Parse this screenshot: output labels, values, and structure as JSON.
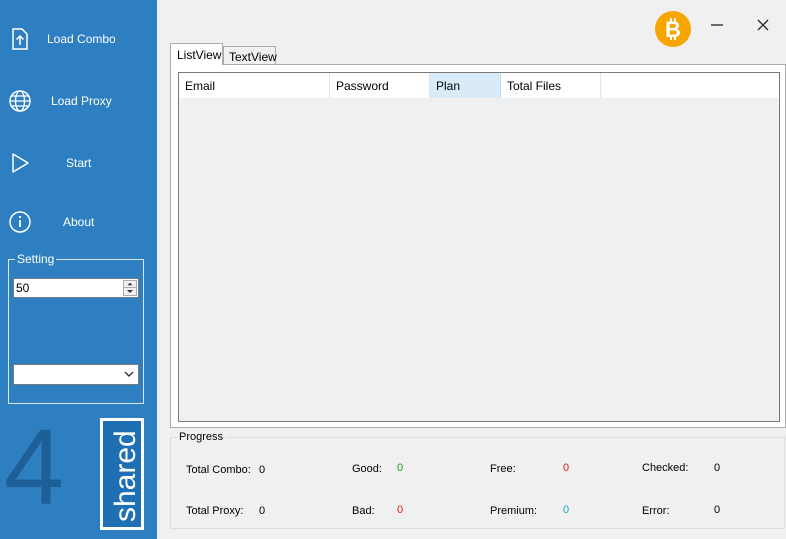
{
  "sidebar": {
    "load_combo": "Load Combo",
    "load_proxy": "Load Proxy",
    "start": "Start",
    "about": "About",
    "setting_label": "Setting",
    "threads_value": "50",
    "dropdown_value": "",
    "logo_number": "4",
    "logo_text": "shared",
    "color": "#2e7fc2"
  },
  "window": {
    "bitcoin_symbol": "B"
  },
  "tabs": [
    {
      "label": "ListView",
      "active": true
    },
    {
      "label": "TextView",
      "active": false
    }
  ],
  "listview": {
    "columns": [
      "Email",
      "Password",
      "Plan",
      "Total Files"
    ],
    "rows": []
  },
  "progress": {
    "label": "Progress",
    "total_combo_label": "Total Combo:",
    "total_combo_value": "0",
    "total_proxy_label": "Total Proxy:",
    "total_proxy_value": "0",
    "good_label": "Good:",
    "good_value": "0",
    "bad_label": "Bad:",
    "bad_value": "0",
    "free_label": "Free:",
    "free_value": "0",
    "premium_label": "Premium:",
    "premium_value": "0",
    "checked_label": "Checked:",
    "checked_value": "0",
    "error_label": "Error:",
    "error_value": "0"
  }
}
